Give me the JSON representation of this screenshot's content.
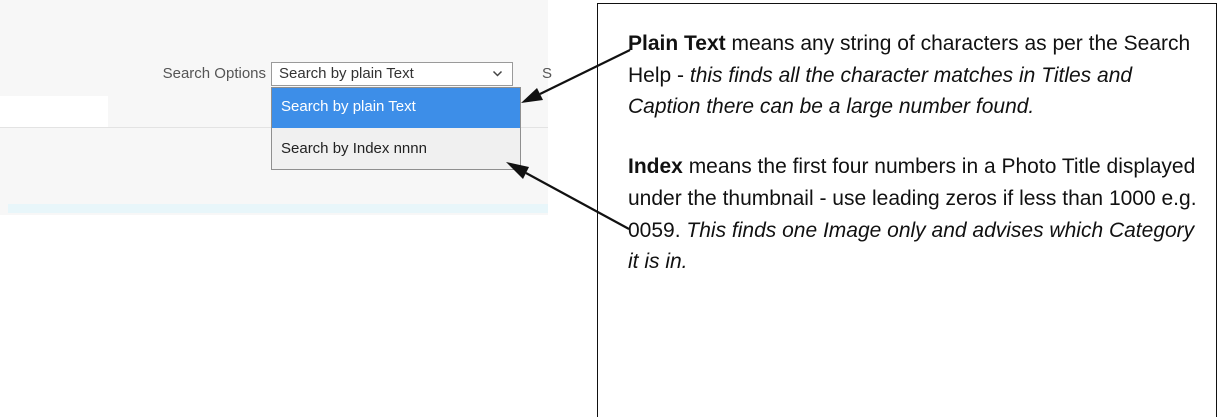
{
  "search_panel": {
    "label": "Search Options",
    "select_value": "Search by plain Text",
    "next_control_glyph": "S",
    "options": [
      "Search by plain Text",
      "Search by Index nnnn"
    ],
    "selected_index": 0,
    "dropdown_open": true,
    "colors": {
      "selected_option_bg": "#3d8ee8",
      "selected_option_text": "#ffffff",
      "bottom_band": "#e8f6fa"
    }
  },
  "annotation": {
    "plain_text": {
      "term": "Plain Text",
      "text": " means  any string of characters as per the Search Help - ",
      "emphasis": "this finds all the character matches in Titles and Caption there can be a large number  found."
    },
    "index": {
      "term": "Index",
      "text": " means the first four numbers in a Photo Title displayed under the thumbnail - use leading zeros if less than 1000 e.g.  0059. ",
      "emphasis": "This finds one Image only and advises which Category it is in."
    }
  },
  "icons": {
    "select_chevron": "chevron-down-icon",
    "pointer_arrows": "arrow-icon"
  }
}
